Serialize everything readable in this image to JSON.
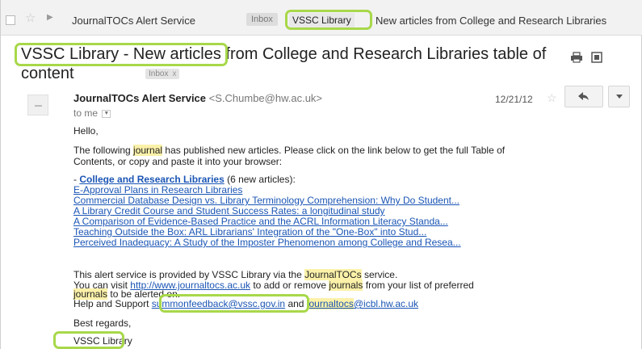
{
  "list_row": {
    "sender": "JournalTOCs Alert Service",
    "inbox_label": "Inbox",
    "folder_label": "VSSC Library",
    "subject_snippet": "New articles from College and Research Libraries"
  },
  "message": {
    "subject_part1": "VSSC Library - New articles",
    "subject_part2": " from College and Research Libraries table of",
    "subject_part3": "content",
    "inbox_chip": "Inbox",
    "inbox_chip_close": "x",
    "from_name": "JournalTOCs Alert Service",
    "from_email": "<S.Chumbe@hw.ac.uk>",
    "to": "to me",
    "date": "12/21/12"
  },
  "body": {
    "greeting": "Hello,",
    "intro_a": "The following ",
    "intro_journal": "journal",
    "intro_b": " has published new articles. Please click on the link below to get the full Table of",
    "intro_line2": "Contents, or copy and paste it into your browser:",
    "journal_prefix": "- ",
    "journal_name": "College and Research Libraries",
    "journal_count": " (6 new articles):",
    "articles": [
      "E-Approval Plans in Research Libraries",
      "Commercial Database Design vs. Library Terminology Comprehension: Why Do Student...",
      "A Library Credit Course and Student Success Rates: a longitudinal study",
      "A Comparison of Evidence-Based Practice and the ACRL Information Literacy Standa...",
      "Teaching Outside the Box: ARL Librarians' Integration of the \"One-Box\" into Stud...",
      "Perceived Inadequacy: A Study of the Imposter Phenomenon among College and Resea..."
    ],
    "service_a": "This alert service is provided by VSSC Library via the ",
    "service_brand": "JournalTOCs",
    "service_b": " service.",
    "visit_a": "You can visit ",
    "visit_url": "http://www.journaltocs.ac.uk",
    "visit_b": " to add or remove ",
    "visit_journals": "journals",
    "visit_c": " from your list of preferred",
    "alert_journals": "journals",
    "alert_rest": " to be alerted on.",
    "support_a": "Help and Support ",
    "support_email1": "summonfeedback@vssc.gov.in",
    "support_b": " and ",
    "support_email2_a": "journaltocs",
    "support_email2_b": "@icbl.hw.ac.uk",
    "regards": "Best regards,",
    "signature": "VSSC Library"
  },
  "colors": {
    "annotation": "#a8d84a",
    "link": "#1a55b5",
    "highlight": "#fbf1a9"
  },
  "icons": [
    "star-icon",
    "importance-icon",
    "print-icon",
    "new-window-icon",
    "avatar-icon",
    "reply-icon",
    "more-icon",
    "dropdown-caret-icon"
  ]
}
